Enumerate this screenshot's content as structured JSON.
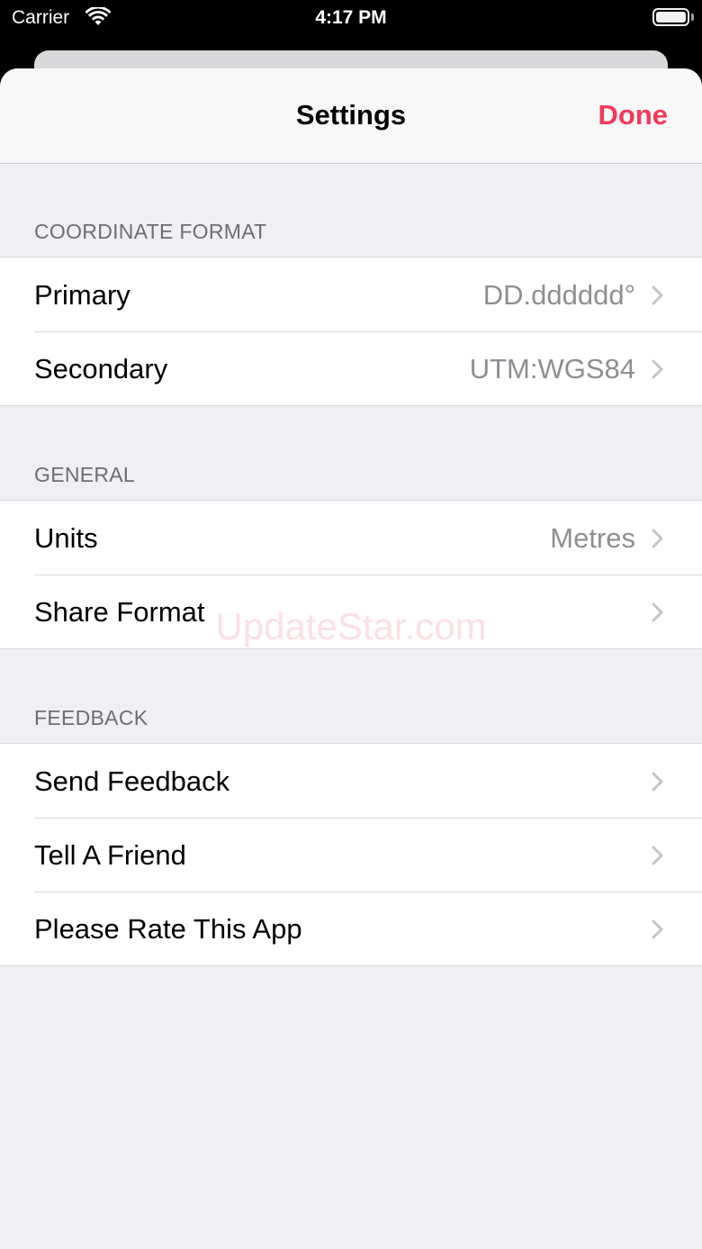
{
  "status_bar": {
    "carrier": "Carrier",
    "time": "4:17 PM"
  },
  "nav": {
    "title": "Settings",
    "done_label": "Done"
  },
  "accent_color": "#f2395a",
  "sections": [
    {
      "header": "COORDINATE FORMAT",
      "rows": [
        {
          "label": "Primary",
          "value": "DD.dddddd°"
        },
        {
          "label": "Secondary",
          "value": "UTM:WGS84"
        }
      ]
    },
    {
      "header": "GENERAL",
      "rows": [
        {
          "label": "Units",
          "value": "Metres"
        },
        {
          "label": "Share Format",
          "value": ""
        }
      ]
    },
    {
      "header": "FEEDBACK",
      "rows": [
        {
          "label": "Send Feedback",
          "value": ""
        },
        {
          "label": "Tell A Friend",
          "value": ""
        },
        {
          "label": "Please Rate This App",
          "value": ""
        }
      ]
    }
  ],
  "watermark": "UpdateStar.com",
  "icons": {
    "wifi": "wifi-icon",
    "battery": "battery-icon",
    "chevron": "chevron-right-icon"
  }
}
